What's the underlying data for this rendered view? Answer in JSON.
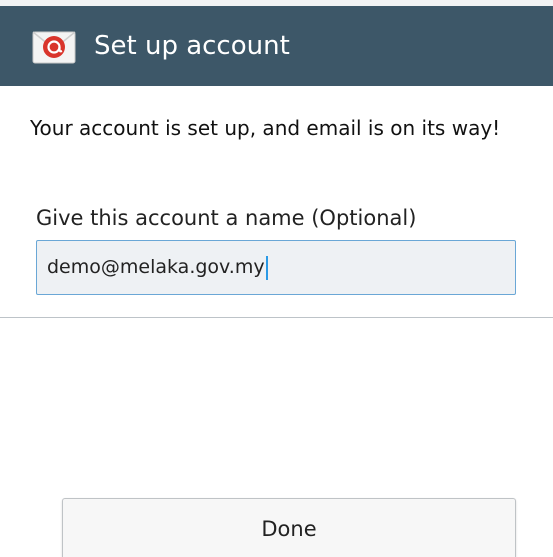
{
  "header": {
    "title": "Set up account",
    "icon": "email-app-icon",
    "background": "#3d5768"
  },
  "main": {
    "message": "Your account is set up, and email is on its way!",
    "account_name_label": "Give this account a name (Optional)",
    "account_name_value": "demo@melaka.gov.my"
  },
  "footer": {
    "done_label": "Done"
  },
  "colors": {
    "input_focus_border": "#6aa7d6",
    "caret": "#2a9ae6"
  }
}
